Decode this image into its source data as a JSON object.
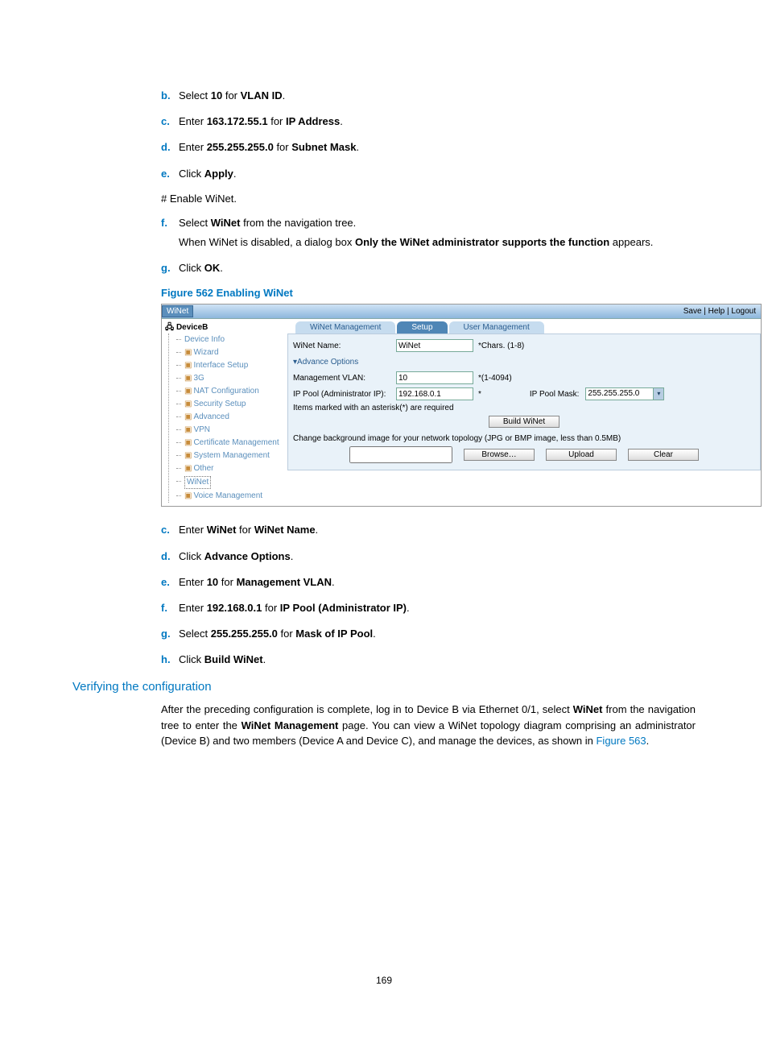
{
  "steps1": {
    "b": {
      "pre": "Select ",
      "v": "10",
      "post": " for ",
      "bold": "VLAN ID",
      "tail": "."
    },
    "c": {
      "pre": "Enter ",
      "v": "163.172.55.1",
      "post": " for ",
      "bold": "IP Address",
      "tail": "."
    },
    "d": {
      "pre": "Enter ",
      "v": "255.255.255.0",
      "post": " for ",
      "bold": "Subnet Mask",
      "tail": "."
    },
    "e": {
      "pre": "Click ",
      "bold": "Apply",
      "tail": "."
    },
    "hash": "# Enable WiNet.",
    "f": {
      "pre": "Select ",
      "bold": "WiNet",
      "post": " from the navigation tree.",
      "sub": {
        "a": "When WiNet is disabled, a dialog box ",
        "b": "Only the WiNet administrator supports the function",
        "c": " appears."
      }
    },
    "g": {
      "pre": "Click ",
      "bold": "OK",
      "tail": "."
    }
  },
  "figure_caption": "Figure 562 Enabling WiNet",
  "ui": {
    "titlebar": "WiNet",
    "links": {
      "save": "Save",
      "help": "Help",
      "logout": "Logout"
    },
    "device": "DeviceB",
    "tree": [
      "Device Info",
      "Wizard",
      "Interface Setup",
      "3G",
      "NAT Configuration",
      "Security Setup",
      "Advanced",
      "VPN",
      "Certificate Management",
      "System Management",
      "Other",
      "WiNet",
      "Voice Management"
    ],
    "tabs": [
      "WiNet Management",
      "Setup",
      "User Management"
    ],
    "labels": {
      "name": "WiNet Name:",
      "adv": "Advance Options",
      "vlan": "Management VLAN:",
      "ip_pool": "IP Pool (Administrator IP):",
      "ip_mask": "IP Pool Mask:"
    },
    "values": {
      "name": "WiNet",
      "name_hint": "*Chars. (1-8)",
      "vlan": "10",
      "vlan_hint": "*(1-4094)",
      "ip_pool": "192.168.0.1",
      "ip_pool_hint": "*",
      "ip_mask": "255.255.255.0"
    },
    "asterisk_note": "Items marked with an asterisk(*) are required",
    "build_btn": "Build WiNet",
    "bg_note": "Change background image for your network topology (JPG or BMP image, less than 0.5MB)",
    "browse": "Browse…",
    "upload": "Upload",
    "clear": "Clear"
  },
  "steps2": {
    "c": {
      "pre": "Enter ",
      "v": "WiNet",
      "post": " for ",
      "bold": "WiNet Name",
      "tail": "."
    },
    "d": {
      "pre": "Click ",
      "bold": "Advance Options",
      "tail": "."
    },
    "e": {
      "pre": "Enter ",
      "v": "10",
      "post": " for ",
      "bold": "Management VLAN",
      "tail": "."
    },
    "f": {
      "pre": "Enter ",
      "v": "192.168.0.1",
      "post": " for ",
      "bold": "IP Pool (Administrator IP)",
      "tail": "."
    },
    "g": {
      "pre": "Select ",
      "v": "255.255.255.0",
      "post": " for ",
      "bold": "Mask of IP Pool",
      "tail": "."
    },
    "h": {
      "pre": "Click ",
      "bold": "Build WiNet",
      "tail": "."
    }
  },
  "h2": "Verifying the configuration",
  "para": {
    "a": "After the preceding configuration is complete, log in to Device B via Ethernet 0/1, select ",
    "b": "WiNet",
    "c": " from the navigation tree to enter the ",
    "d": "WiNet Management",
    "e": " page. You can view a WiNet topology diagram comprising an administrator (Device B) and two members (Device A and Device C), and manage the devices, as shown in ",
    "link": "Figure 563",
    "f": "."
  },
  "pagenum": "169"
}
